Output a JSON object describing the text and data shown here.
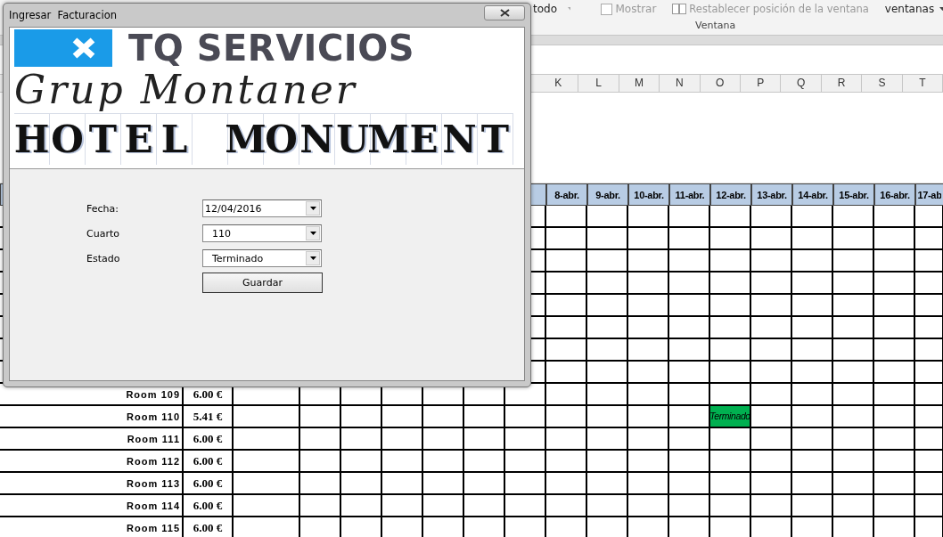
{
  "ribbon": {
    "arrange_label": "todo",
    "show_checkbox": {
      "label": "Mostrar",
      "checked": false
    },
    "reset_button": "Restablecer posición de la ventana",
    "windows_button": "ventanas",
    "group_label": "Ventana"
  },
  "sheet": {
    "column_letters": [
      "K",
      "L",
      "M",
      "N",
      "O",
      "P",
      "Q",
      "R",
      "S",
      "T"
    ],
    "date_headers": [
      "8-abr.",
      "9-abr.",
      "10-abr.",
      "11-abr.",
      "12-abr.",
      "13-abr.",
      "14-abr.",
      "15-abr.",
      "16-abr.",
      "17-ab"
    ],
    "rows": [
      {
        "room": "Room 109",
        "price": "6.00 €"
      },
      {
        "room": "Room 110",
        "price": "5.41 €",
        "cells": [
          null,
          null,
          null,
          null,
          {
            "text": "Terminado",
            "kind": "finished"
          }
        ]
      },
      {
        "room": "Room 111",
        "price": "6.00 €"
      },
      {
        "room": "Room 112",
        "price": "6.00 €"
      },
      {
        "room": "Room 113",
        "price": "6.00 €"
      },
      {
        "room": "Room 114",
        "price": "6.00 €"
      },
      {
        "room": "Room 115",
        "price": "6.00 €"
      }
    ]
  },
  "dialog": {
    "title": "Ingresar  Facturacion",
    "logo_text": "TQ SERVICIOS",
    "signature": "Grup Montaner",
    "banner_letters": "HOTEL MONUMENT",
    "fields": [
      {
        "label": "Fecha:",
        "value": "12/04/2016"
      },
      {
        "label": "Cuarto",
        "value": "110"
      },
      {
        "label": "Estado",
        "value": "Terminado"
      }
    ],
    "button": "Guardar"
  }
}
